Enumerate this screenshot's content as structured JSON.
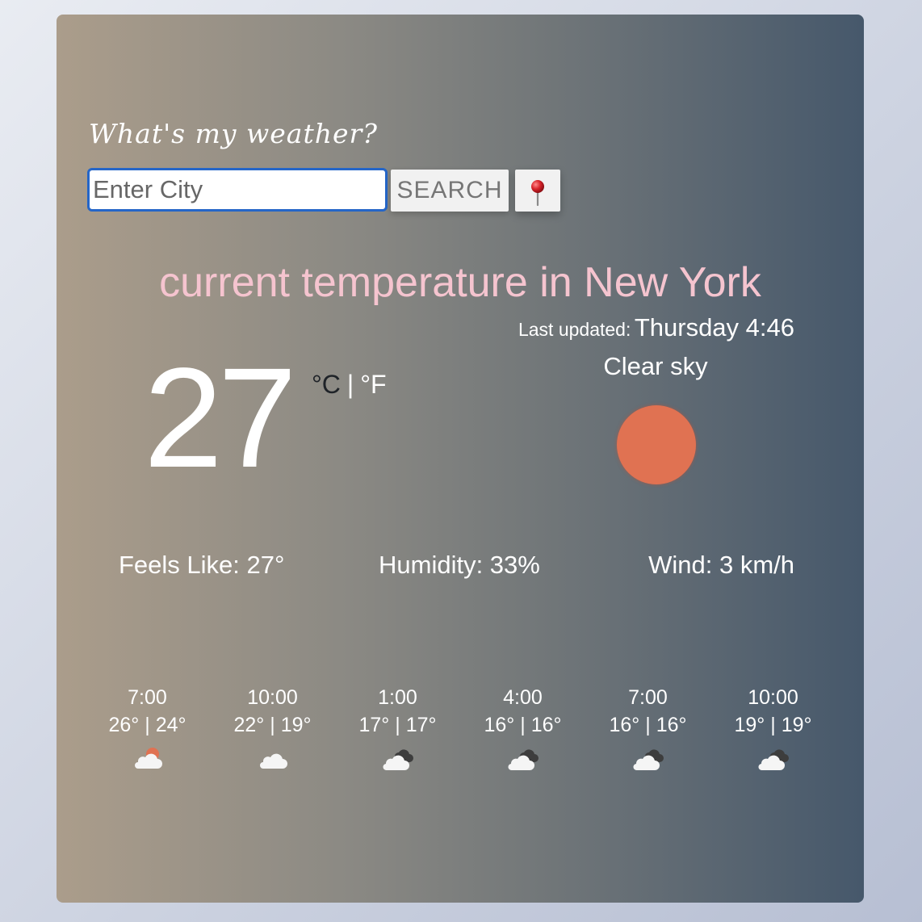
{
  "app": {
    "heading": "What's my weather?"
  },
  "search": {
    "placeholder": "Enter City",
    "button_label": "SEARCH",
    "location_icon": "pushpin-icon"
  },
  "current": {
    "title_prefix": "current temperature in ",
    "city": "New York",
    "last_updated_label": "Last updated:",
    "last_updated_value": "Thursday 4:46",
    "temperature": "27",
    "unit_celsius": "°C",
    "unit_separator": "|",
    "unit_fahrenheit": "°F",
    "description": "Clear sky",
    "icon": "sun-icon"
  },
  "stats": {
    "feels_like": "Feels Like: 27°",
    "humidity": "Humidity: 33%",
    "wind": "Wind: 3 km/h"
  },
  "forecast": [
    {
      "time": "7:00",
      "temps": "26° | 24°",
      "icon": "partly-cloudy-icon"
    },
    {
      "time": "10:00",
      "temps": "22° | 19°",
      "icon": "cloud-icon"
    },
    {
      "time": "1:00",
      "temps": "17° | 17°",
      "icon": "overcast-cloud-icon"
    },
    {
      "time": "4:00",
      "temps": "16° | 16°",
      "icon": "overcast-cloud-icon"
    },
    {
      "time": "7:00",
      "temps": "16° | 16°",
      "icon": "overcast-cloud-icon"
    },
    {
      "time": "10:00",
      "temps": "19° | 19°",
      "icon": "overcast-cloud-icon"
    }
  ],
  "colors": {
    "city_text": "#f5c4cf",
    "sun": "#e07252",
    "input_border": "#2566c8"
  }
}
